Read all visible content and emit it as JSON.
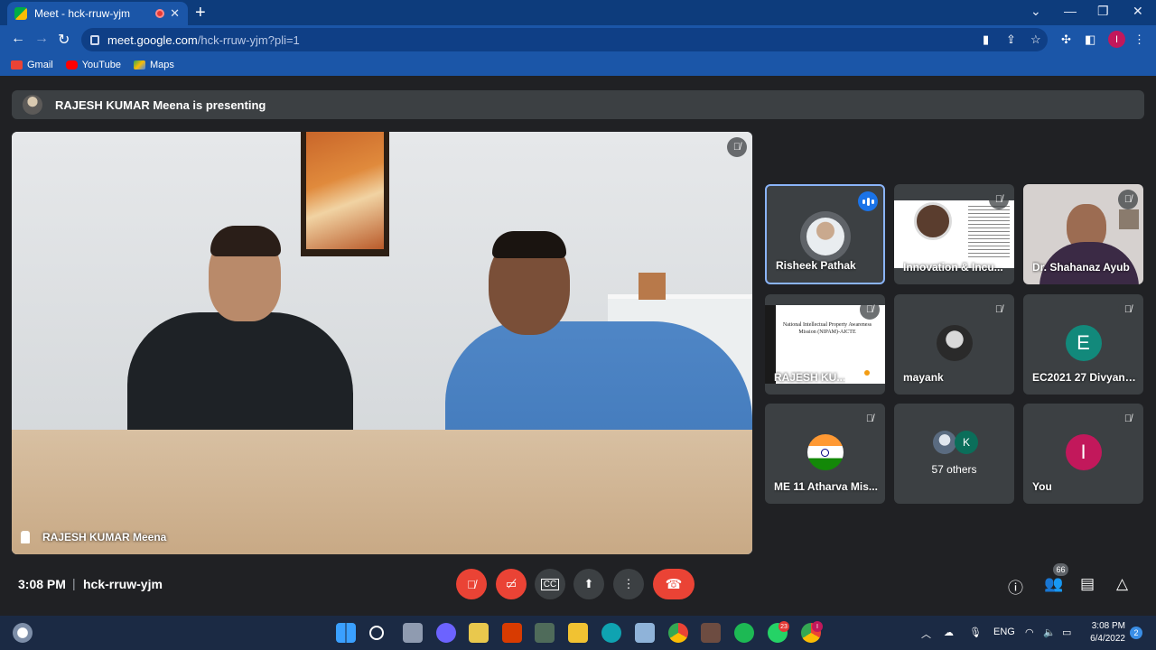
{
  "browser": {
    "tab_title": "Meet - hck-rruw-yjm",
    "close_tab": "✕",
    "new_tab": "+",
    "window": {
      "minimize": "⌄",
      "min": "—",
      "max": "❐",
      "close": "✕"
    },
    "url_host": "meet.google.com",
    "url_path": "/hck-rruw-yjm?pli=1",
    "profile_initial": "I",
    "bookmarks": [
      {
        "label": "Gmail",
        "color": "#ea4335"
      },
      {
        "label": "YouTube",
        "color": "#ff0000"
      },
      {
        "label": "Maps",
        "color": "#34a853"
      }
    ]
  },
  "meet": {
    "presenting_banner": "RAJESH KUMAR Meena is presenting",
    "main_name": "RAJESH KUMAR Meena",
    "tiles": [
      {
        "name": "Risheek Pathak",
        "active": true
      },
      {
        "name": "Innovation & Incu..."
      },
      {
        "name": "Dr. Shahanaz Ayub"
      },
      {
        "name": "RAJESH KU..."
      },
      {
        "name": "mayank"
      },
      {
        "name": "EC2021 27 Divyans...",
        "initial": "E",
        "color": "#12897b"
      },
      {
        "name": "ME 11 Atharva Mis..."
      },
      {
        "name": "57 others",
        "extra_initial": "K",
        "extra_color": "#0b6e5a"
      },
      {
        "name": "You",
        "initial": "I",
        "color": "#c2185b"
      }
    ],
    "slide_text": "National Intellectual Property Awareness Mission (NIPAM)-AICTE",
    "time": "3:08 PM",
    "meeting_code": "hck-rruw-yjm",
    "participants_count": "66"
  },
  "taskbar": {
    "language": "ENG",
    "clock_time": "3:08 PM",
    "clock_date": "6/4/2022",
    "notifications": "2",
    "whatsapp_badge": "23",
    "chrome_badge": "I"
  }
}
